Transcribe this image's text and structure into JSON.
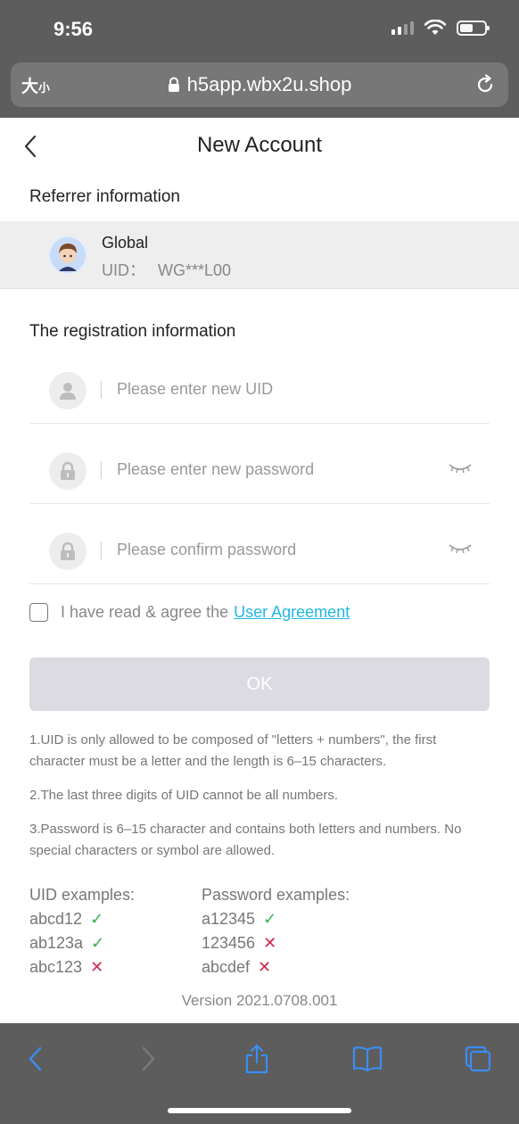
{
  "status_bar": {
    "time": "9:56"
  },
  "browser": {
    "text_size_label": "大",
    "text_size_small": "小",
    "url": "h5app.wbx2u.shop"
  },
  "header": {
    "title": "New Account"
  },
  "referrer": {
    "section_title": "Referrer information",
    "name": "Global",
    "uid_label": "UID：",
    "uid_value": "WG***L00"
  },
  "registration": {
    "section_title": "The registration information",
    "uid_placeholder": "Please enter new UID",
    "password_placeholder": "Please enter new password",
    "confirm_placeholder": "Please confirm password"
  },
  "agreement": {
    "text": "I have read & agree the",
    "link": "User Agreement",
    "checked": false
  },
  "ok_button": "OK",
  "rules": [
    "1.UID is only allowed to be composed of \"letters + numbers\", the first character must be a letter and the length is 6–15 characters.",
    "2.The last three digits of UID cannot be all numbers.",
    "3.Password is 6–15 character and contains both letters and numbers. No special characters or symbol are allowed."
  ],
  "uid_examples": {
    "title": "UID examples:",
    "items": [
      {
        "value": "abcd12",
        "mark": "✓",
        "valid": true
      },
      {
        "value": "ab123a",
        "mark": "✓",
        "valid": true
      },
      {
        "value": "abc123",
        "mark": "✕",
        "valid": false
      }
    ]
  },
  "password_examples": {
    "title": "Password examples:",
    "items": [
      {
        "value": "a12345",
        "mark": "✓",
        "valid": true
      },
      {
        "value": "123456",
        "mark": "✕",
        "valid": false
      },
      {
        "value": "abcdef",
        "mark": "✕",
        "valid": false
      }
    ]
  },
  "version": "Version 2021.0708.001",
  "colors": {
    "chrome": "#5d5d5d",
    "link": "#1fb7e0",
    "valid": "#36b24a",
    "invalid": "#d22a4e",
    "ok_button": "#dcdbe2",
    "toolbar_icon": "#3b8df5"
  },
  "icons": [
    "signal-icon",
    "wifi-icon",
    "battery-icon",
    "lock-icon",
    "reload-icon",
    "back-icon",
    "user-icon",
    "password-lock-icon",
    "eye-closed-icon",
    "share-icon",
    "bookmarks-icon",
    "tabs-icon",
    "forward-icon"
  ]
}
